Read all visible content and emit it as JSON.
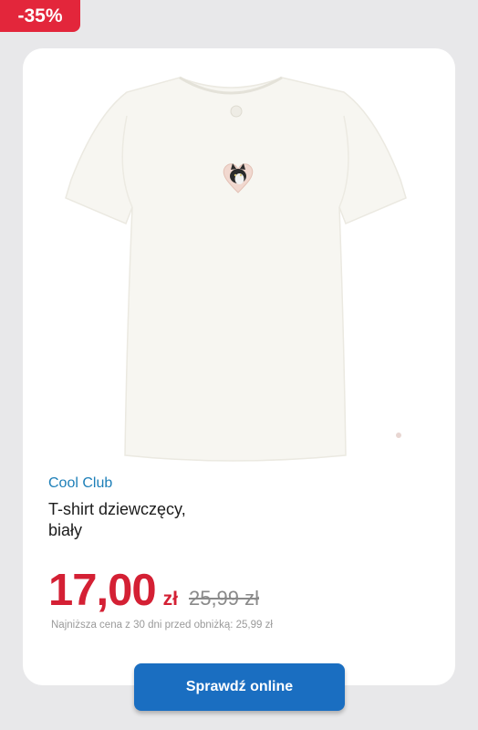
{
  "badge": {
    "discount": "-35%"
  },
  "product": {
    "brand": "Cool Club",
    "name_line1": "T-shirt dziewczęcy,",
    "name_line2": "biały",
    "image_alt": "t-shirt-image"
  },
  "price": {
    "current": "17,00",
    "currency": "zł",
    "old": "25,99 zł",
    "lowest_note": "Najniższa cena z 30 dni przed obniżką: 25,99 zł"
  },
  "cta": {
    "label": "Sprawdź online"
  },
  "colors": {
    "badge": "#e3263b",
    "price": "#d42034",
    "brand": "#1d7fb8",
    "button": "#1a6ec1"
  }
}
